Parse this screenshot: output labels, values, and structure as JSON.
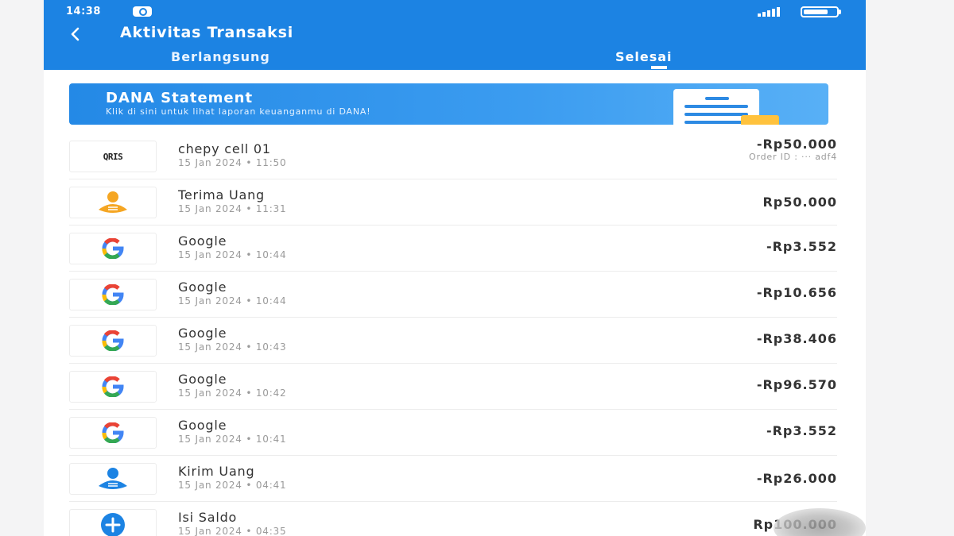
{
  "status_bar": {
    "time": "14:38",
    "battery": "56"
  },
  "header": {
    "title": "Aktivitas Transaksi",
    "tabs": [
      {
        "label": "Berlangsung",
        "active": false
      },
      {
        "label": "Selesai",
        "active": true
      }
    ]
  },
  "banner": {
    "title": "DANA Statement",
    "subtitle": "Klik di sini untuk lihat laporan keuanganmu di DANA!"
  },
  "transactions": [
    {
      "name": "chepy cell 01",
      "date": "15 Jan 2024 • 11:50",
      "amount": "-Rp50.000",
      "order_id": "Order ID : ··· adf4",
      "icon": "qris-logo"
    },
    {
      "name": "Terima Uang",
      "date": "15 Jan 2024 • 11:31",
      "amount": "Rp50.000",
      "icon": "receive-money-icon"
    },
    {
      "name": "Google",
      "date": "15 Jan 2024 • 10:44",
      "amount": "-Rp3.552",
      "icon": "google-icon"
    },
    {
      "name": "Google",
      "date": "15 Jan 2024 • 10:44",
      "amount": "-Rp10.656",
      "icon": "google-icon"
    },
    {
      "name": "Google",
      "date": "15 Jan 2024 • 10:43",
      "amount": "-Rp38.406",
      "icon": "google-icon"
    },
    {
      "name": "Google",
      "date": "15 Jan 2024 • 10:42",
      "amount": "-Rp96.570",
      "icon": "google-icon"
    },
    {
      "name": "Google",
      "date": "15 Jan 2024 • 10:41",
      "amount": "-Rp3.552",
      "icon": "google-icon"
    },
    {
      "name": "Kirim Uang",
      "date": "15 Jan 2024 • 04:41",
      "amount": "-Rp26.000",
      "icon": "send-money-icon"
    },
    {
      "name": "Isi Saldo",
      "date": "15 Jan 2024 • 04:35",
      "amount": "Rp100.000",
      "icon": "top-up-icon"
    }
  ],
  "qris_label": "QRIS",
  "colors": {
    "brand": "#1c83e3",
    "orange": "#f5a623",
    "google_blue": "#4285F4",
    "google_red": "#EA4335",
    "google_yellow": "#FBBC05",
    "google_green": "#34A853"
  }
}
